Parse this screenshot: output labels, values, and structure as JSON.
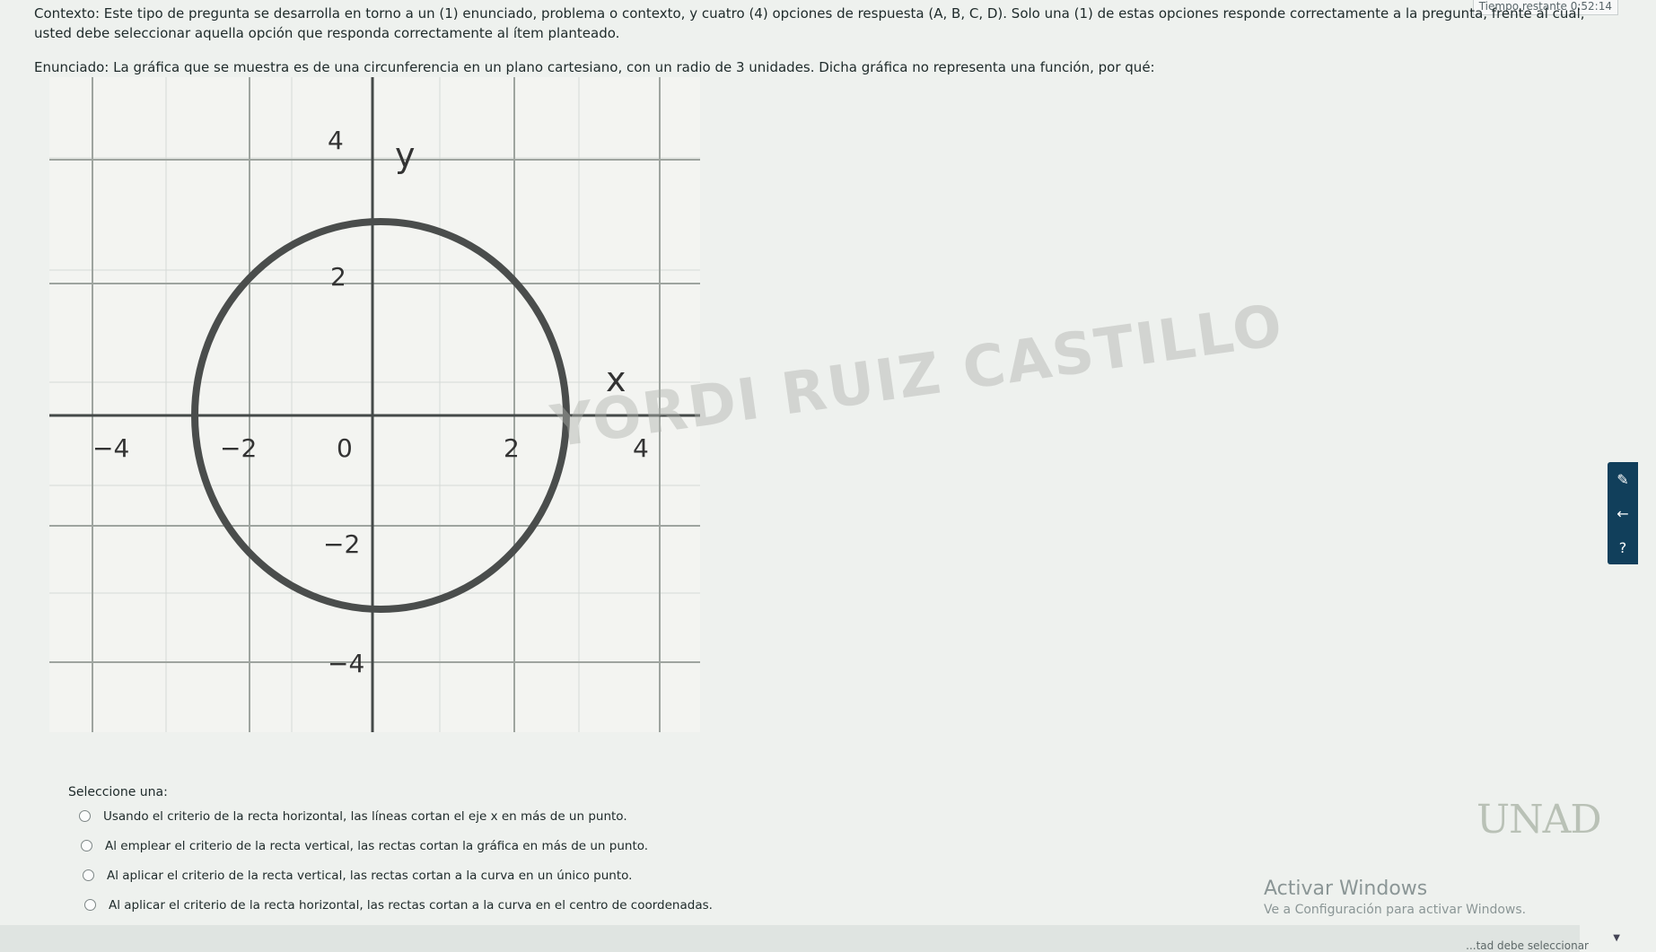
{
  "header": {
    "timer": "Tiempo restante 0:52:14"
  },
  "question": {
    "context": "Contexto: Este tipo de pregunta se desarrolla en torno a un (1) enunciado, problema o contexto, y cuatro (4) opciones de respuesta (A, B, C, D). Solo una (1) de estas opciones responde correctamente a la pregunta, frente al cual, usted debe seleccionar aquella opción que responda correctamente al ítem planteado.",
    "statement": "Enunciado: La gráfica que se muestra es de una circunferencia en un plano cartesiano, con un radio de 3 unidades. Dicha gráfica no representa una función, por qué:"
  },
  "graph": {
    "x_label": "x",
    "y_label": "y",
    "x_ticks": [
      "−4",
      "−2",
      "0",
      "2",
      "4"
    ],
    "y_ticks": [
      "4",
      "2",
      "−2",
      "−4"
    ],
    "watermark": "YORDI RUIZ CASTILLO"
  },
  "answer": {
    "select_label": "Seleccione una:",
    "options": [
      "Usando el criterio de la recta horizontal, las líneas cortan el eje x en más de un punto.",
      "Al emplear el criterio de la recta vertical, las rectas cortan la gráfica en más de un punto.",
      "Al aplicar el criterio de la recta vertical, las rectas cortan a la curva en un único punto.",
      "Al aplicar el criterio de la recta horizontal, las rectas cortan a la curva en el centro de coordenadas."
    ]
  },
  "sidebar": {
    "tools": [
      {
        "icon": "palette-icon",
        "glyph": "✎"
      },
      {
        "icon": "back-arrow-icon",
        "glyph": "←"
      },
      {
        "icon": "help-icon",
        "glyph": "?"
      }
    ]
  },
  "windows": {
    "activate_title": "Activar Windows",
    "activate_sub": "Ve a Configuración para activar Windows."
  },
  "logo": {
    "text": "UNAD"
  },
  "footer": {
    "text": "...tad debe seleccionar"
  }
}
